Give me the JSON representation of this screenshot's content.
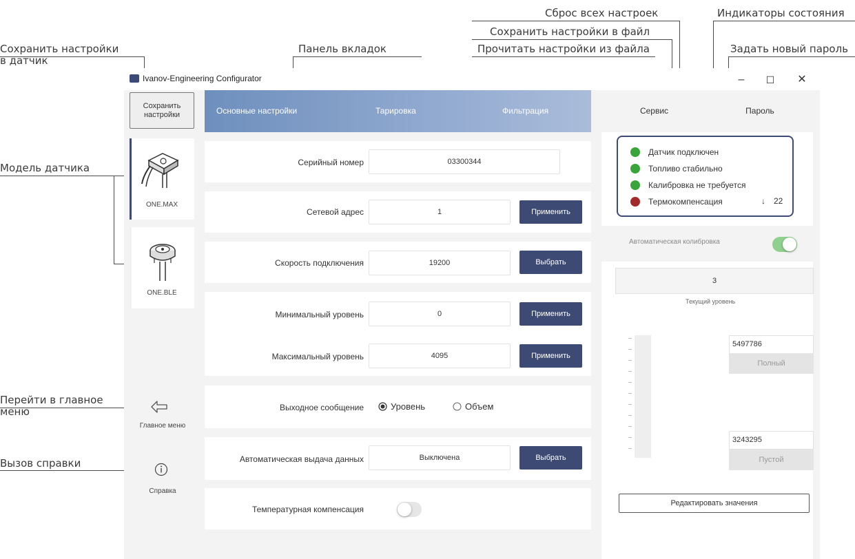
{
  "annotations": {
    "save_to_sensor": "Сохранить настройки\nв датчик",
    "tab_panel": "Панель вкладок",
    "reset_all": "Сброс всех настроек",
    "save_to_file": "Сохранить настройки в файл",
    "read_from_file": "Прочитать настройки из файла",
    "status_indicators": "Индикаторы состояния",
    "new_password": "Задать новый пароль",
    "sensor_model": "Модель датчика",
    "go_main_menu": "Перейти в главное\nменю",
    "call_help": "Вызов справки"
  },
  "window": {
    "title": "Ivanov-Engineering Configurator",
    "minimize": "–",
    "maximize": "☐",
    "close": "✕"
  },
  "sidebar": {
    "save_button": "Сохранить\nнастройки",
    "sensors": [
      {
        "label": "ONE.MAX",
        "selected": true
      },
      {
        "label": "ONE.BLE",
        "selected": false
      }
    ],
    "main_menu": "Главное меню",
    "help": "Справка",
    "accent_color": "#3d4a73"
  },
  "tabs": [
    "Основные настройки",
    "Тарировка",
    "Фильтрация"
  ],
  "form": {
    "serial": {
      "label": "Серийный номер",
      "value": "03300344"
    },
    "address": {
      "label": "Сетевой адрес",
      "value": "1",
      "button": "Применить"
    },
    "speed": {
      "label": "Скорость подключения",
      "value": "19200",
      "button": "Выбрать"
    },
    "min_level": {
      "label": "Минимальный уровень",
      "value": "0",
      "button": "Применить"
    },
    "max_level": {
      "label": "Максимальный уровень",
      "value": "4095",
      "button": "Применить"
    },
    "output": {
      "label": "Выходное сообщение",
      "option_level": "Уровень",
      "option_volume": "Объем",
      "selected": "Уровень"
    },
    "auto_output": {
      "label": "Автоматическая выдача данных",
      "value": "Выключена",
      "button": "Выбрать"
    },
    "temp_comp": {
      "label": "Температурная компенсация",
      "enabled": false
    }
  },
  "right_panel": {
    "tabs": [
      "Сервис",
      "Пароль"
    ],
    "status": [
      {
        "text": "Датчик подключен",
        "color": "#3aa53a"
      },
      {
        "text": "Топливо стабильно",
        "color": "#3aa53a"
      },
      {
        "text": "Калибровка не требуется",
        "color": "#3aa53a"
      },
      {
        "text": "Термокомпенсация",
        "color": "#a32a2a",
        "extra": "22",
        "extra_icon": "↓"
      }
    ],
    "auto_calibration": {
      "label": "Автоматическая колибровка",
      "enabled": true,
      "color": "#8fd08f"
    },
    "current_level": {
      "value": "3",
      "label": "Текущий уровень"
    },
    "full": {
      "value": "5497786",
      "button": "Полный"
    },
    "empty": {
      "value": "3243295",
      "button": "Пустой"
    },
    "edit_button": "Редактировать значения"
  }
}
